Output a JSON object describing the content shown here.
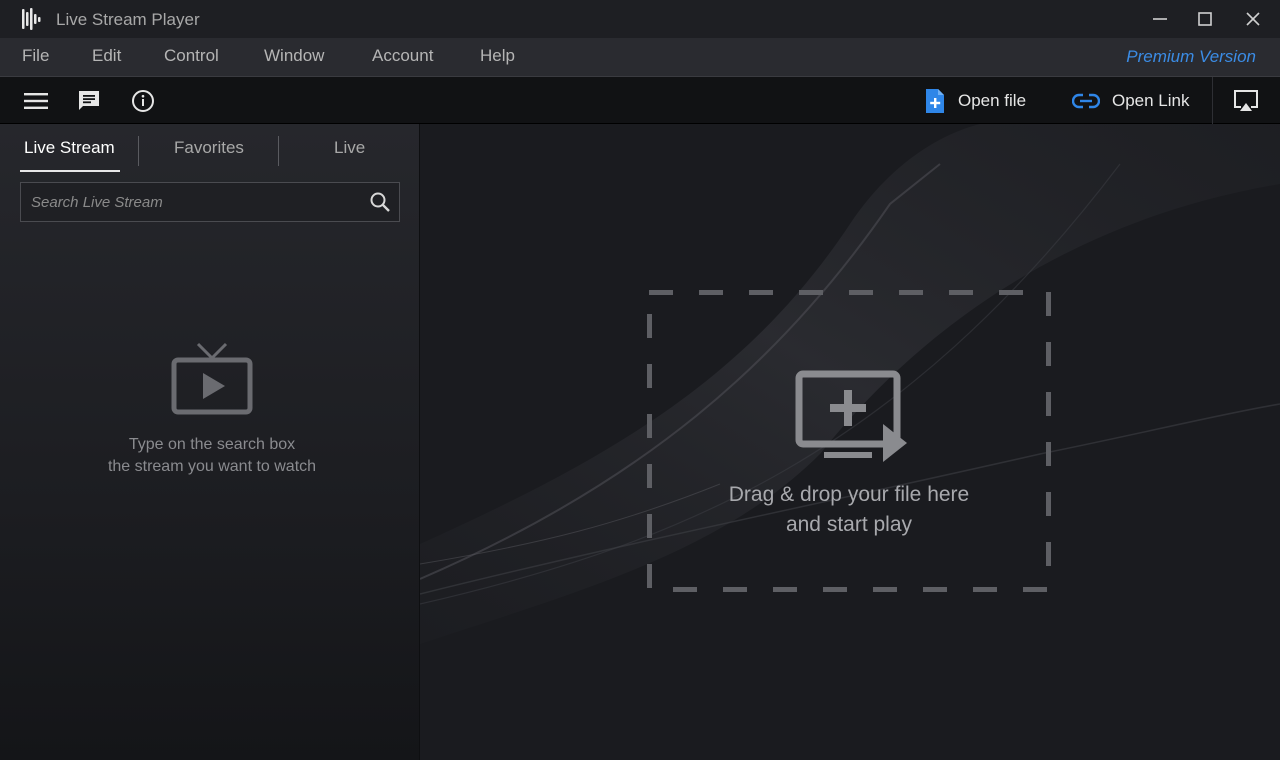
{
  "window": {
    "title": "Live Stream Player",
    "logo_icon": "waveform-logo-icon"
  },
  "menu": {
    "items": [
      "File",
      "Edit",
      "Control",
      "Window",
      "Account",
      "Help"
    ],
    "premium_label": "Premium Version"
  },
  "toolbar": {
    "open_file_label": "Open file",
    "open_link_label": "Open Link"
  },
  "sidebar": {
    "tabs": [
      "Live Stream",
      "Favorites",
      "Live"
    ],
    "active_tab": "Live Stream",
    "search_placeholder": "Search Live Stream",
    "hint_line1": "Type on the search box",
    "hint_line2": "the stream you want to watch"
  },
  "main": {
    "drop_line1": "Drag & drop your file here",
    "drop_line2": "and start play"
  },
  "colors": {
    "accent": "#3b8ce5",
    "background": "#1a1b1f",
    "menubar": "#2a2b30",
    "toolbar": "#111214"
  }
}
